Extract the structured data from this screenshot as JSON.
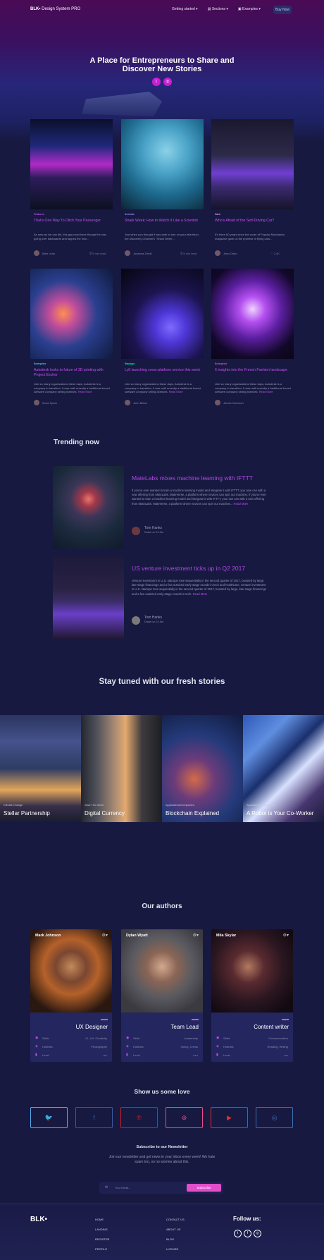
{
  "nav": {
    "brand_bold": "BLK•",
    "brand_rest": " Design System PRO",
    "links": [
      "Getting started ▾",
      "▤ Sections ▾",
      "▣ Examples ▾"
    ],
    "buy_now": "Buy Now"
  },
  "hero": {
    "title_line1": "A Place for Entrepreneurs to Share and",
    "title_line2": "Discover New Stories",
    "social": [
      "twitter-icon",
      "dribbble-icon"
    ]
  },
  "cards": [
    {
      "category": "Features",
      "category_color": "#c74ff3",
      "title": "That's One Way To Ditch Your Passenger",
      "desc": "As near as we can tell, this guy must have thought he was going over backwards and tapped the rear...",
      "read_more": "",
      "author": "Mike John",
      "meta": "⏱ 5 min read"
    },
    {
      "category": "Animals",
      "category_color": "#8c8cf0",
      "title": "Shark Week: How to Watch It Like a Scientist",
      "desc": "Just when you thought it was safe to turn on your television, the Discovery Channel's \"Shark Week\"...",
      "read_more": "",
      "author": "Johanna Zmidt",
      "meta": "⏱ 5 min read"
    },
    {
      "category": "Cars",
      "category_color": "#e6a5ff",
      "title": "Who's Afraid of the Self-Driving Car?",
      "desc": "It's been 60 years since the cover of Popular Mechanics magazine gave us the promise of flying cars...",
      "read_more": "",
      "author": "Jean Orlan",
      "meta": "♡ 2.4K"
    },
    {
      "category": "Enterprise",
      "category_color": "#4fc2f7",
      "title": "Autodesk looks to future of 3D printing with Project Escher",
      "desc": "Like so many organizations these days, Autodesk is a company in transition. It was until recently a traditional boxed software company selling licenses.",
      "read_more": "Read More",
      "author": "Anna Spark",
      "meta": ""
    },
    {
      "category": "Startups",
      "category_color": "#00f2c3",
      "title": "Lyft launching cross-platform service this week",
      "desc": "Like so many organizations these days, Autodesk is a company in transition. It was until recently a traditional boxed software company selling licenses.",
      "read_more": "Read More",
      "author": "John Black",
      "meta": ""
    },
    {
      "category": "Enterprise",
      "category_color": "#e14eca",
      "title": "6 insights into the French Fashion landscape",
      "desc": "Like so many organizations these days, Autodesk is a company in transition. It was until recently a traditional boxed software company selling licenses.",
      "read_more": "Read More",
      "author": "James Newman",
      "meta": ""
    }
  ],
  "trending": {
    "heading": "Trending now",
    "items": [
      {
        "title": "MateLabs mixes machine learning with IFTTT",
        "desc": "If you've ever wanted to train a machine learning model and integrate it with IFTTT, you now can with a new offering from MateLabs. MateVerse, a platform where novices can spin out machine, If you've ever wanted to train a machine learning model and integrate it with IFTTT, you now can with a new offering from MateLabs. MateVerse, a platform where novices can spin out machine...",
        "read_more": "Read More",
        "author": "Tom Hanks",
        "date": "Drawn on 23 Jan"
      },
      {
        "title": "US venture investment ticks up in Q2 2017",
        "desc": "Venture investment in U.S. startups rose sequentially in the second quarter of 2017, boosted by large, late-stage financings and a few outsized early-stage rounds in tech and healthcare. venture investment in U.S. startups rose sequentially in the second quarter of 2017, boosted by large, late-stage financings and a few outsized early-stage rounds in tech.",
        "read_more": "Read More",
        "author": "Tom Hanks",
        "date": "Drawn on 23 Jan"
      }
    ]
  },
  "fresh": {
    "heading": "Stay tuned with our fresh stories",
    "stories": [
      {
        "category": "Climate Change",
        "title": "Stellar Partnership"
      },
      {
        "category": "Save The World",
        "title": "Digital Currency"
      },
      {
        "category": "Applications/Companies",
        "title": "Blockchain Explained"
      },
      {
        "category": "Applications/Companies",
        "title": "A Robot is Your Co-Worker"
      }
    ]
  },
  "authors": {
    "heading": "Our authors",
    "items": [
      {
        "name": "Mark Johnson",
        "role": "UX Designer",
        "rows": [
          [
            "Skills",
            "UI, UX, Creativity"
          ],
          [
            "Hobbies",
            "Photography"
          ],
          [
            "Level",
            "••••"
          ]
        ]
      },
      {
        "name": "Dylan Wyatt",
        "role": "Team Lead",
        "rows": [
          [
            "Skills",
            "Leadership"
          ],
          [
            "Hobbies",
            "Skiing, Chess"
          ],
          [
            "Level",
            "•••••"
          ]
        ]
      },
      {
        "name": "Mila Skylar",
        "role": "Content writer",
        "rows": [
          [
            "Skills",
            "Communication"
          ],
          [
            "Hobbies",
            "Reading, Writing"
          ],
          [
            "Level",
            "••••"
          ]
        ]
      }
    ]
  },
  "love": {
    "heading": "Show us some love",
    "buttons": [
      {
        "icon": "twitter-icon",
        "glyph": "🐦",
        "color": "#55acee"
      },
      {
        "icon": "facebook-icon",
        "glyph": "f",
        "color": "#3b5998"
      },
      {
        "icon": "pinterest-icon",
        "glyph": "℗",
        "color": "#cc2127"
      },
      {
        "icon": "dribbble-icon",
        "glyph": "⊛",
        "color": "#ea4c89"
      },
      {
        "icon": "youtube-icon",
        "glyph": "▶",
        "color": "#e52d27"
      },
      {
        "icon": "instagram-icon",
        "glyph": "◎",
        "color": "#3b6fb5"
      }
    ]
  },
  "newsletter": {
    "heading": "Subscribe to our Newsletter",
    "text_line1": "Join our newsletter and get news in your inbox every week! We hate",
    "text_line2": "spam too, so no worries about this.",
    "placeholder": "Your Email...",
    "button": "Subscribe"
  },
  "footer": {
    "brand": "BLK•",
    "col1": [
      "HOME",
      "LANDING",
      "REGISTER",
      "PROFILE"
    ],
    "col2": [
      "CONTACT US",
      "ABOUT US",
      "BLOG",
      "LICENSE"
    ],
    "follow": "Follow us:",
    "social": [
      "twitter-icon",
      "facebook-icon",
      "dribbble-icon"
    ]
  }
}
